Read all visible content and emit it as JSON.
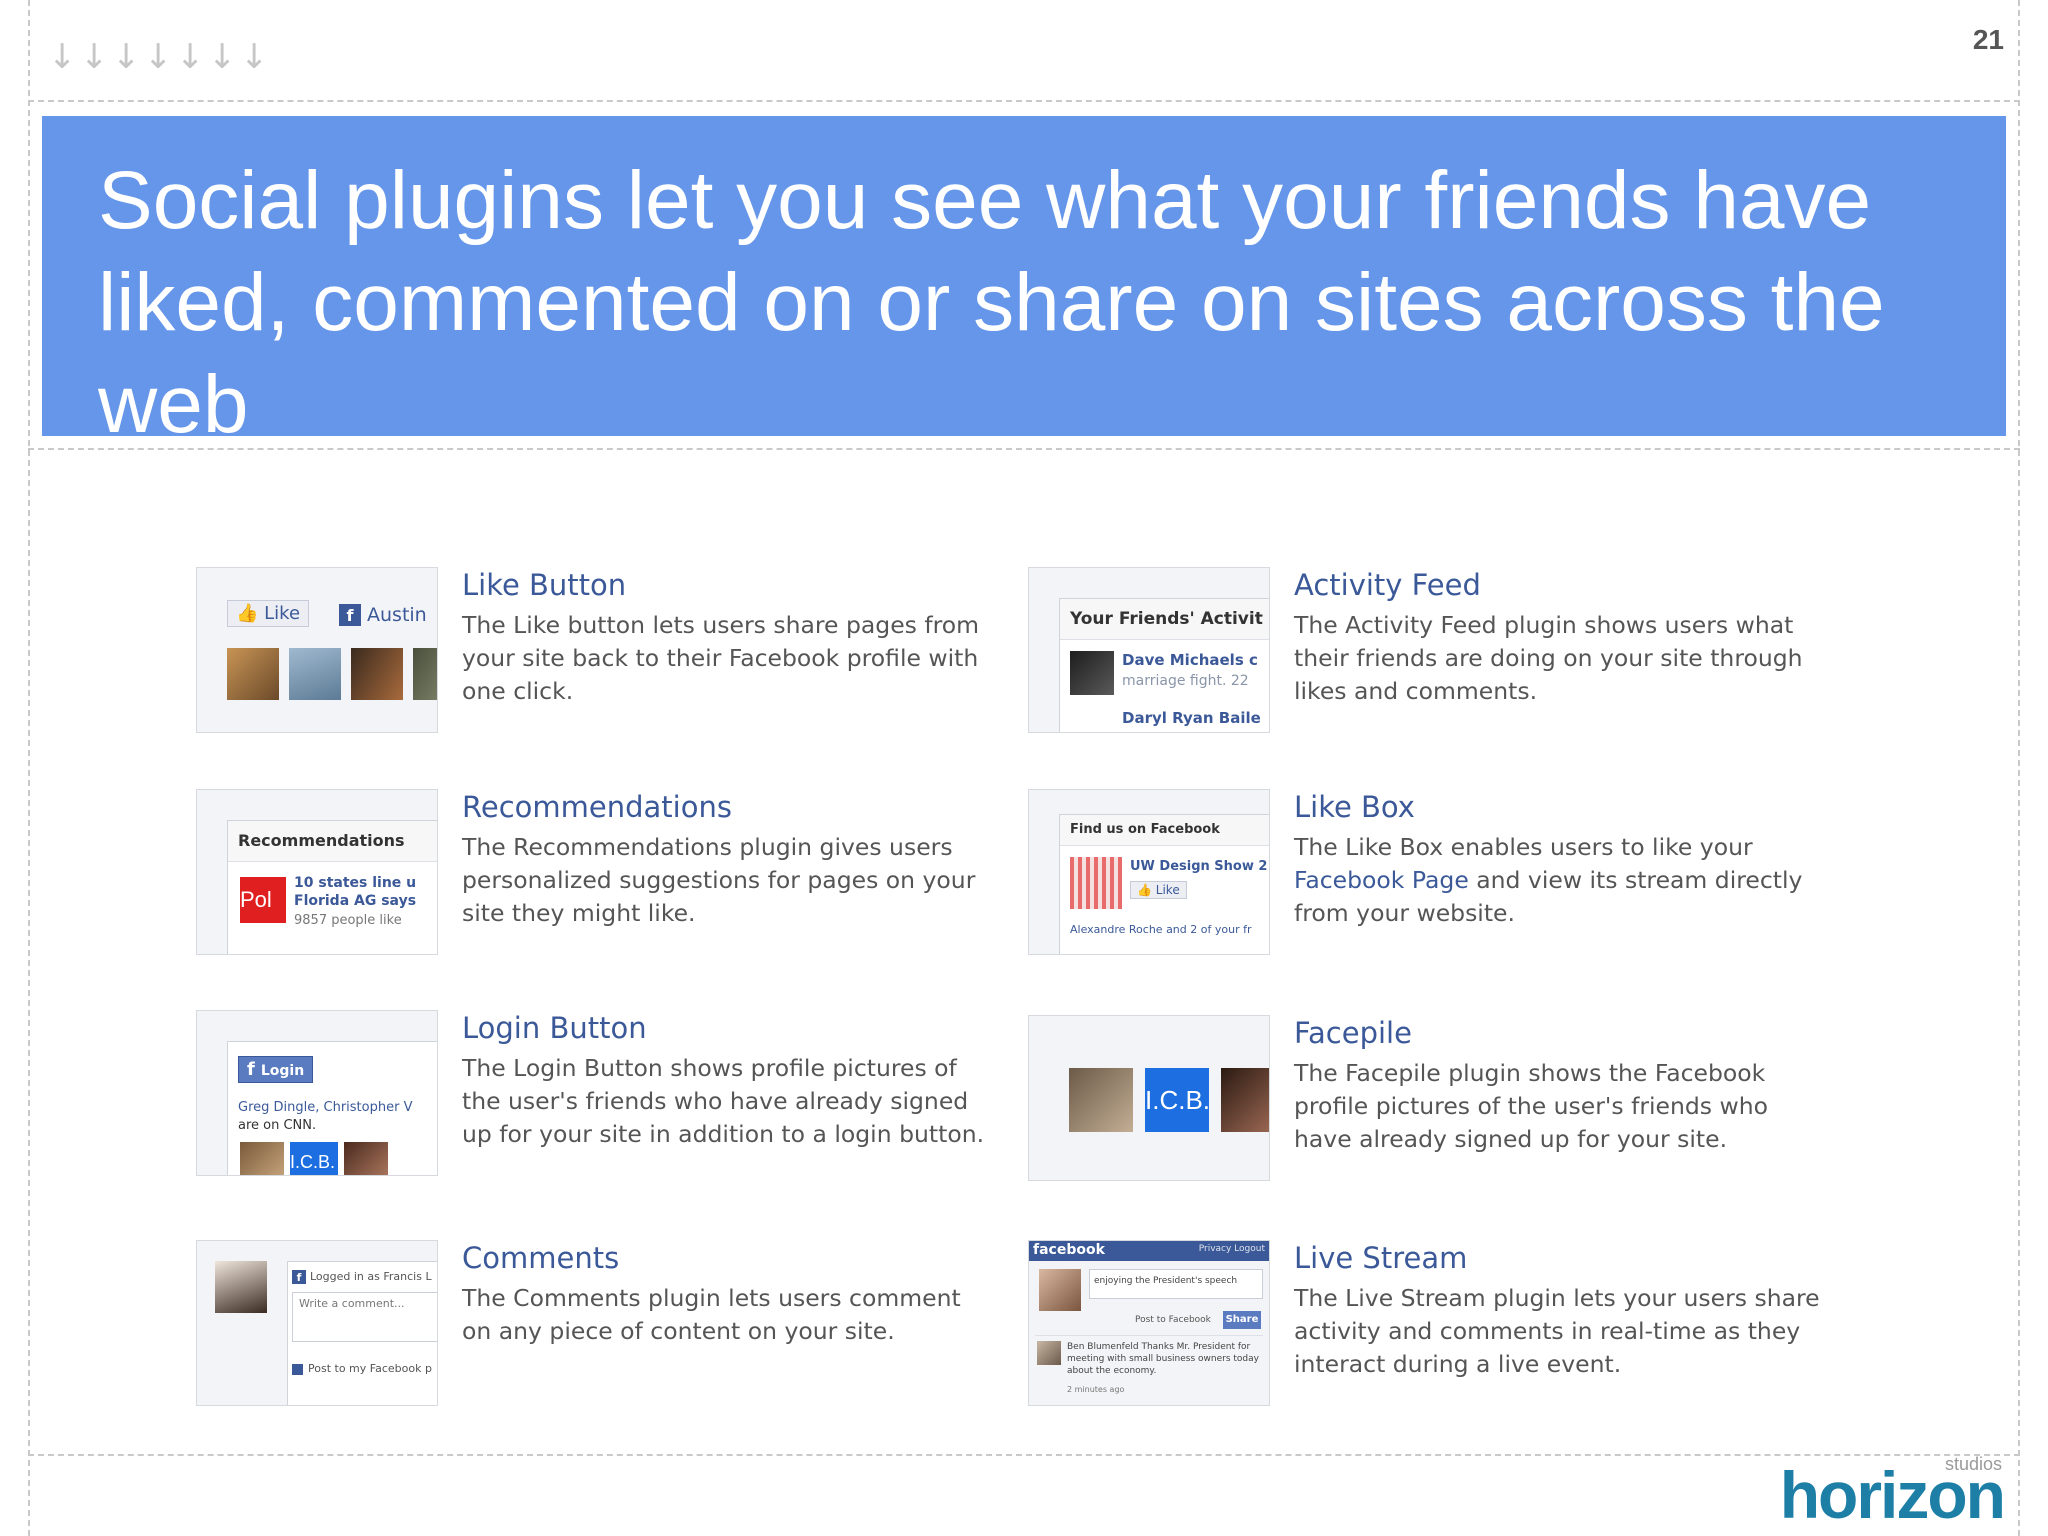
{
  "slide": {
    "number": "21",
    "title": "Social plugins let you see what your friends have liked, commented on or share on sites across the web",
    "nav_arrow_glyph": "↓",
    "nav_arrows": 7,
    "banner_color": "#6596ea",
    "link_color": "#3b5998"
  },
  "plugins": [
    {
      "title": "Like Button",
      "description": "The Like button lets users share pages from your site back to their Facebook profile with one click.",
      "thumb": {
        "like_label": "Like",
        "name": "Austin"
      }
    },
    {
      "title": "Activity Feed",
      "description": "The Activity Feed plugin shows users what their friends are doing on your site through likes and comments.",
      "thumb": {
        "header": "Your Friends' Activit",
        "line1": "Dave Michaels c",
        "line2": "marriage fight. 22",
        "line3": "Daryl Ryan Baile"
      }
    },
    {
      "title": "Recommendations",
      "description": "The Recommendations plugin gives users personalized suggestions for pages on your site they might like.",
      "thumb": {
        "header": "Recommendations",
        "line1": "10 states line u",
        "line2": "Florida AG says",
        "line3": "9857 people like",
        "icon_text": "Pol"
      }
    },
    {
      "title": "Like Box",
      "description_before": "The Like Box enables users to like your ",
      "description_link": "Facebook Page",
      "description_after": " and view its stream directly from your website.",
      "thumb": {
        "header": "Find us on Facebook",
        "line1": "UW Design Show 2",
        "like_label": "Like",
        "footer": "Alexandre Roche and 2 of your fr"
      }
    },
    {
      "title": "Login Button",
      "description": "The Login Button shows profile pictures of the user's friends who have already signed up for your site in addition to a login button.",
      "thumb": {
        "button": "Login",
        "line1": "Greg Dingle, Christopher V",
        "line2": "are on CNN.",
        "badge": "I.C.B."
      }
    },
    {
      "title": "Facepile",
      "description": "The Facepile plugin shows the Facebook profile pictures of the user's friends who have already signed up for your site.",
      "thumb": {
        "badge": "I.C.B."
      }
    },
    {
      "title": "Comments",
      "description": "The Comments plugin lets users comment on any piece of content on your site.",
      "thumb": {
        "line1": "Logged in as Francis L",
        "placeholder": "Write a comment...",
        "checkbox": "Post to my Facebook p"
      }
    },
    {
      "title": "Live Stream",
      "description": "The Live Stream plugin lets your users share activity and comments in real-time as they interact during a live event.",
      "thumb": {
        "brand": "facebook",
        "nav": "Privacy  Logout",
        "status": "enjoying the President's speech",
        "post": "Post to Facebook",
        "share": "Share",
        "comment": "Ben Blumenfeld  Thanks Mr. President for meeting with small business owners today about the economy.",
        "time": "2 minutes ago"
      }
    }
  ],
  "branding": {
    "logo": "horizon",
    "logo_sub": "studios",
    "logo_color": "#1e7fa6"
  }
}
